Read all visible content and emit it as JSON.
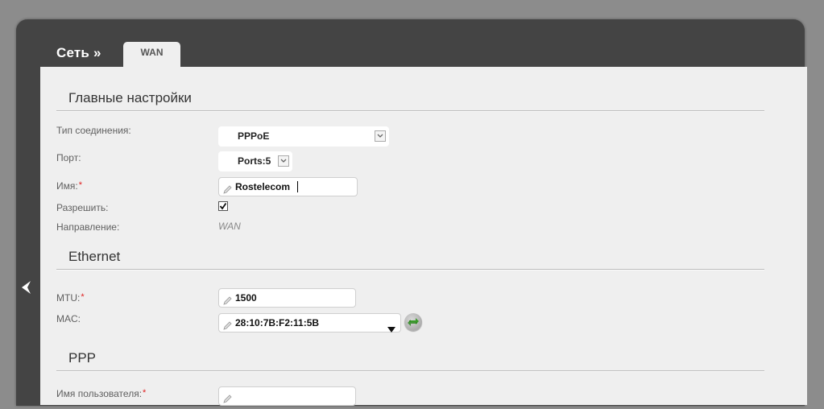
{
  "breadcrumb": {
    "root": "Сеть »",
    "tab": "WAN"
  },
  "sections": {
    "main": "Главные настройки",
    "ethernet": "Ethernet",
    "ppp": "PPP"
  },
  "fields": {
    "connection_type": {
      "label": "Тип соединения:",
      "value": "PPPoE"
    },
    "port": {
      "label": "Порт:",
      "value": "Ports:5"
    },
    "name": {
      "label": "Имя:",
      "required_mark": "*",
      "value": "Rostelecom"
    },
    "enable": {
      "label": "Разрешить:",
      "checked": true
    },
    "direction": {
      "label": "Направление:",
      "value": "WAN"
    },
    "mtu": {
      "label": "MTU:",
      "required_mark": "*",
      "value": "1500"
    },
    "mac": {
      "label": "MAC:",
      "value": "28:10:7B:F2:11:5B"
    },
    "username": {
      "label": "Имя пользователя:",
      "required_mark": "*",
      "value": ""
    }
  },
  "colors": {
    "frame": "#444444",
    "panel": "#efefef",
    "required": "#e02020",
    "refresh_arrows": "#3a9a2a"
  },
  "icons": [
    "back-arrow-icon",
    "pencil-icon",
    "dropdown-arrow-icon",
    "refresh-icon",
    "checkmark-icon"
  ]
}
